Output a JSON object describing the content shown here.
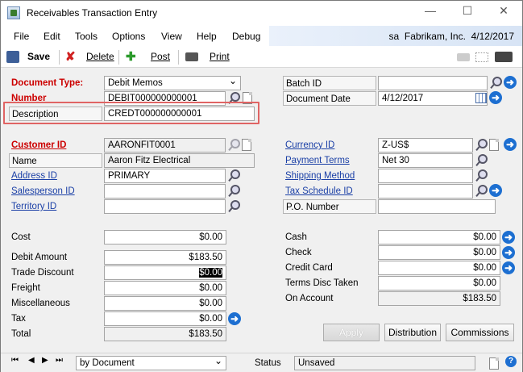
{
  "window": {
    "title": "Receivables Transaction Entry",
    "min": "—",
    "max": "☐",
    "close": "✕"
  },
  "menu": {
    "items": [
      "File",
      "Edit",
      "Tools",
      "Options",
      "View",
      "Help",
      "Debug"
    ],
    "user": "sa",
    "company": "Fabrikam, Inc.",
    "date": "4/12/2017"
  },
  "toolbar": {
    "save": "Save",
    "delete": "Delete",
    "post": "Post",
    "print": "Print"
  },
  "header": {
    "doc_type_label": "Document Type:",
    "doc_type_value": "Debit Memos",
    "number_label": "Number",
    "number_value": "DEBIT000000000001",
    "description_label": "Description",
    "description_value": "CREDT000000000001",
    "batch_label": "Batch ID",
    "batch_value": "",
    "docdate_label": "Document Date",
    "docdate_value": "4/12/2017"
  },
  "customer": {
    "id_label": "Customer ID",
    "id_value": "AARONFIT0001",
    "name_label": "Name",
    "name_value": "Aaron Fitz Electrical",
    "address_label": "Address ID",
    "address_value": "PRIMARY",
    "salesperson_label": "Salesperson ID",
    "salesperson_value": "",
    "territory_label": "Territory ID",
    "territory_value": "",
    "currency_label": "Currency ID",
    "currency_value": "Z-US$",
    "terms_label": "Payment Terms",
    "terms_value": "Net 30",
    "shipping_label": "Shipping Method",
    "shipping_value": "",
    "taxsched_label": "Tax Schedule ID",
    "taxsched_value": "",
    "po_label": "P.O. Number",
    "po_value": ""
  },
  "amounts": {
    "cost_label": "Cost",
    "cost_value": "$0.00",
    "debit_label": "Debit Amount",
    "debit_value": "$183.50",
    "trade_label": "Trade Discount",
    "trade_value": "$0.00",
    "freight_label": "Freight",
    "freight_value": "$0.00",
    "misc_label": "Miscellaneous",
    "misc_value": "$0.00",
    "tax_label": "Tax",
    "tax_value": "$0.00",
    "total_label": "Total",
    "total_value": "$183.50",
    "cash_label": "Cash",
    "cash_value": "$0.00",
    "check_label": "Check",
    "check_value": "$0.00",
    "credit_label": "Credit Card",
    "credit_value": "$0.00",
    "terms_label": "Terms Disc Taken",
    "terms_value": "$0.00",
    "account_label": "On Account",
    "account_value": "$183.50"
  },
  "buttons": {
    "apply": "Apply",
    "distribution": "Distribution",
    "commissions": "Commissions"
  },
  "status": {
    "sort": "by Document",
    "status_label": "Status",
    "status_value": "Unsaved"
  },
  "colors": {
    "accent": "#1d6fd1",
    "required": "#cc0000",
    "link": "#1a3fa6",
    "highlight": "#e06464"
  }
}
